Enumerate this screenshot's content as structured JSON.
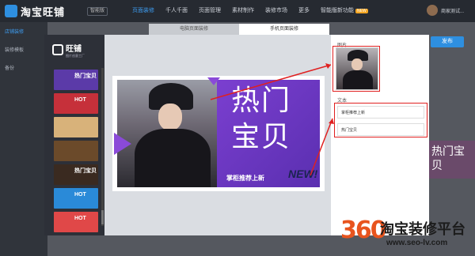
{
  "topbar": {
    "logo_text": "淘宝旺铺",
    "version": "智能版",
    "menu": [
      "页面装修",
      "千人千面",
      "页面管理",
      "素材制作",
      "装修市场",
      "更多",
      "智能版新功能"
    ],
    "new_badge": "NEW",
    "user_name": "商家测试..."
  },
  "leftnav": {
    "items": [
      "店铺装修",
      "装修模板",
      "备份"
    ]
  },
  "tabs": {
    "pc": "电脑页面装修",
    "mobile": "手机页面装修"
  },
  "background": {
    "publish": "发布",
    "card_text": "热门宝贝"
  },
  "editor": {
    "brand_title": "旺铺",
    "brand_sub": "图片创意工厂",
    "thumbs": [
      {
        "label": "热门宝贝",
        "color": "#5b3aa8"
      },
      {
        "label": "HOT",
        "color": "#c6303a"
      },
      {
        "label": "",
        "color": "#d8b27a"
      },
      {
        "label": "",
        "color": "#6b4a2a"
      },
      {
        "label": "热门宝贝",
        "color": "#3a2a20"
      },
      {
        "label": "HOT",
        "color": "#2a8ad8"
      },
      {
        "label": "HOT",
        "color": "#e04848"
      }
    ]
  },
  "banner": {
    "title_line1": "热门",
    "title_line2": "宝贝",
    "subtitle": "掌柜推荐上新",
    "tag": "NEW!"
  },
  "panel": {
    "image_label": "图片",
    "text_label": "文本",
    "text1": "掌柜推荐上新",
    "text2": "热门宝贝"
  },
  "watermark": {
    "number": "360",
    "text": "淘宝装修平台",
    "url": "www.seo-lv.com"
  }
}
